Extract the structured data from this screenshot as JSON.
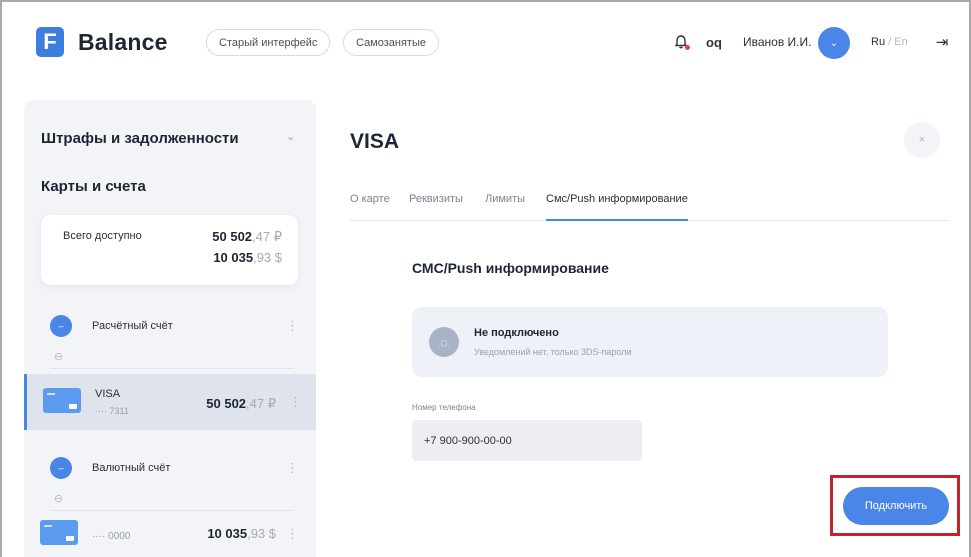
{
  "header": {
    "logo_letter": "F",
    "logo_text": "Balance",
    "old_interface_label": "Старый интерфейс",
    "self_employed_label": "Самозанятые",
    "bell_icon": "bell-icon",
    "glasses_icon": "glasses-icon",
    "glasses_glyph": "oq",
    "user_name": "Иванов И.И.",
    "avatar_glyph": "⌄",
    "lang_active": "Ru",
    "lang_sep": " / ",
    "lang_inactive": "En",
    "logout_glyph": "⇥"
  },
  "sidebar": {
    "fines_title": "Штрафы и задолженности",
    "fines_chevron": "⌄",
    "cards_title": "Карты и счета",
    "total": {
      "label": "Всего доступно",
      "rub_int": "50 502",
      "rub_frac": ",47 ₽",
      "usd_int": "10 035",
      "usd_frac": ",93 $"
    },
    "accounts": [
      {
        "label": "Расчётный счёт",
        "dot_glyph": "–",
        "link_glyph": "⊖",
        "more": "⋮"
      },
      {
        "label": "Валютный счёт",
        "dot_glyph": "–",
        "link_glyph": "⊖",
        "more": "⋮"
      }
    ],
    "cards": [
      {
        "name": "VISA",
        "number": "···· 7311",
        "amount_int": "50 502",
        "amount_frac": ",47 ₽",
        "more": "⋮",
        "active": true
      },
      {
        "name": "",
        "number": "···· 0000",
        "amount_int": "10 035",
        "amount_frac": ",93 $",
        "more": "⋮",
        "active": false
      }
    ]
  },
  "main": {
    "title": "VISA",
    "close_glyph": "×",
    "tabs": [
      "О карте",
      "Реквизиты",
      "Лимиты",
      "Смс/Push информирование"
    ],
    "active_tab": 3,
    "section_title": "СМС/Push информирование",
    "status": {
      "icon_glyph": "◌",
      "title": "Не подключено",
      "subtitle": "Уведомлений нет, только 3DS-пароли"
    },
    "phone_label": "Номер телефона",
    "phone_value": "+7 900-900-00-00",
    "connect_label": "Подключить"
  },
  "colors": {
    "accent": "#4a86e8",
    "highlight_border": "#c4232b",
    "sidebar_bg": "#f2f4f8"
  }
}
